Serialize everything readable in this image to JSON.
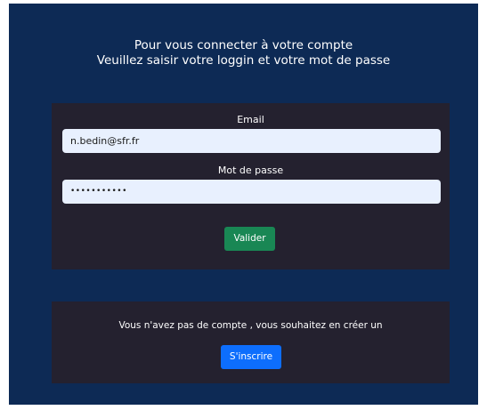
{
  "intro": {
    "line1": "Pour vous connecter à votre compte",
    "line2": "Veuillez saisir votre loggin et votre mot de passe"
  },
  "login": {
    "email_label": "Email",
    "email_value": "n.bedin@sfr.fr",
    "password_label": "Mot de passe",
    "password_mask": "•••••••••••",
    "submit_label": "Valider"
  },
  "signup": {
    "prompt": "Vous n'avez pas de compte , vous souhaitez en créer un",
    "button_label": "S'inscrire"
  },
  "colors": {
    "background": "#0d2a55",
    "panel": "#24212f",
    "input_fill": "#e8f0fe",
    "submit_button": "#198754",
    "signup_button": "#0d6efd"
  }
}
